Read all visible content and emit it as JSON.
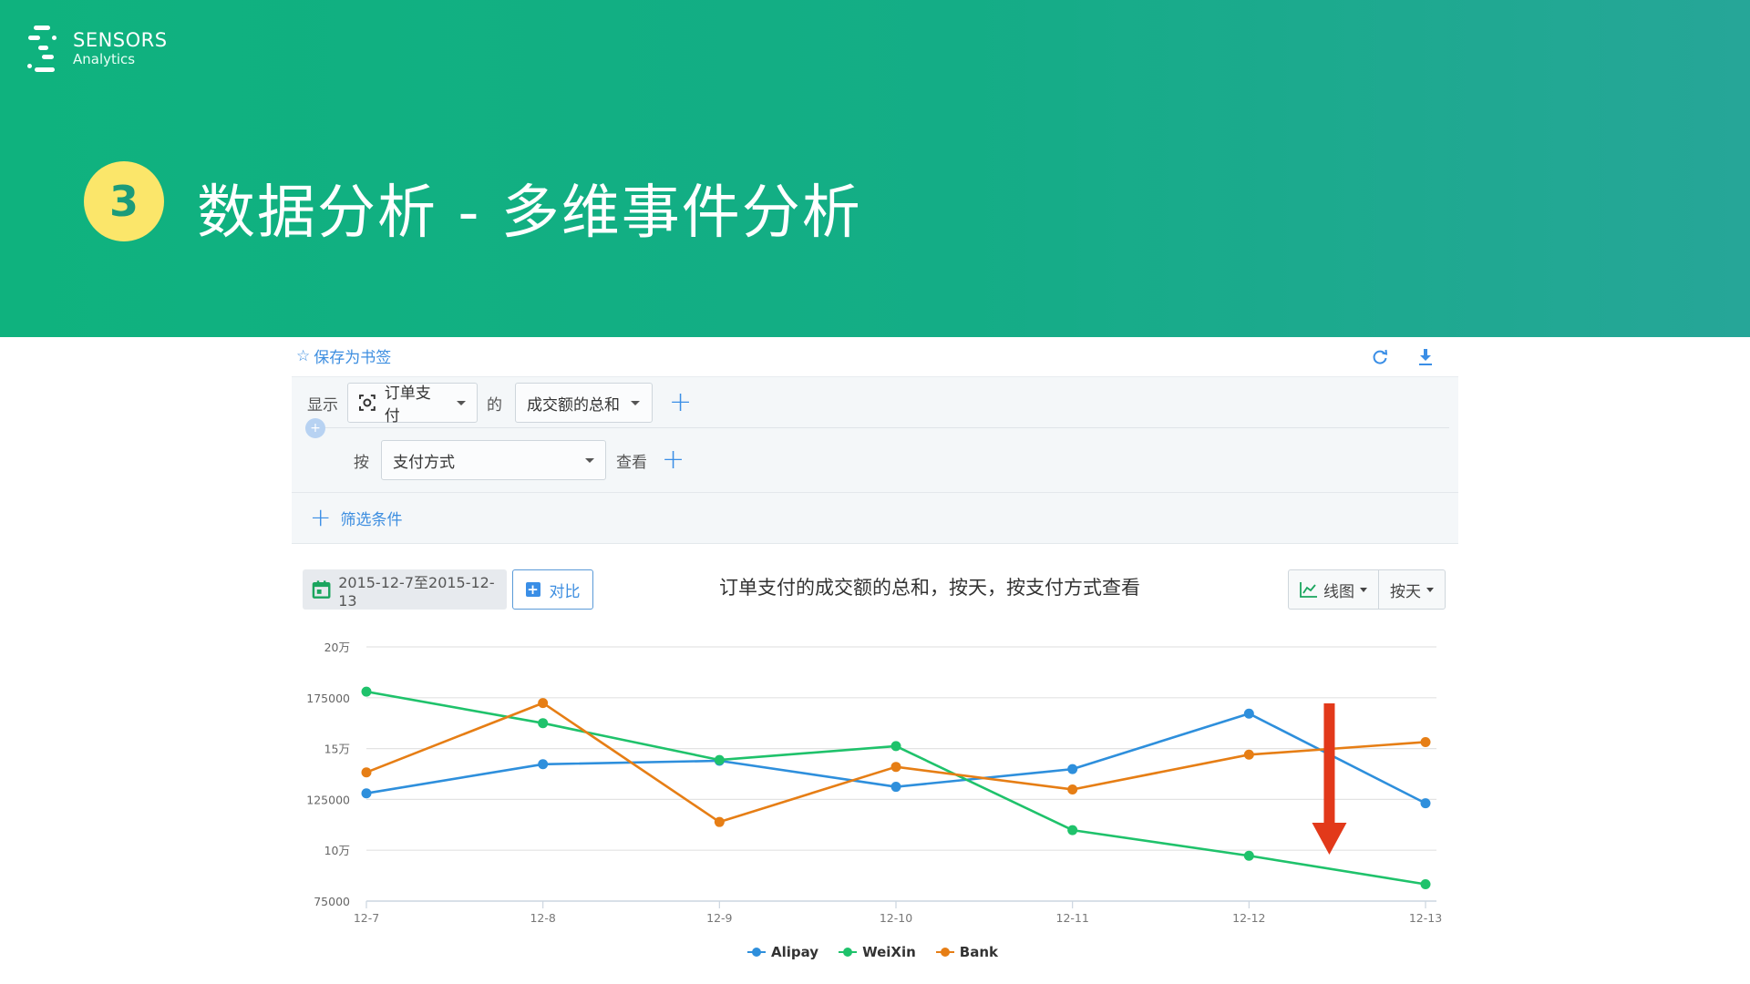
{
  "brand": {
    "name_line1": "SENSORS",
    "name_line2": "Analytics"
  },
  "slide": {
    "step_number": "3",
    "title": "数据分析 - 多维事件分析"
  },
  "toolbar": {
    "bookmark_icon": "star-outline-icon",
    "bookmark_label": "保存为书签",
    "refresh_icon": "refresh-icon",
    "download_icon": "download-icon"
  },
  "query": {
    "show_label": "显示",
    "event_icon": "event-scan-icon",
    "event_value": "订单支付",
    "of_label": "的",
    "metric_value": "成交额的总和",
    "by_label": "按",
    "group_value": "支付方式",
    "view_label": "查看",
    "add_symbol": "+",
    "filter_label": "筛选条件"
  },
  "controls": {
    "date_icon": "calendar-icon",
    "date_range": "2015-12-7至2015-12-13",
    "compare_label": "对比",
    "chart_type_icon": "line-chart-icon",
    "chart_type_label": "线图",
    "granularity_label": "按天"
  },
  "colors": {
    "brand_green": "#12b07f",
    "badge_yellow": "#fbe66a",
    "link_blue": "#3d8ee0",
    "arrow_red": "#e2391a"
  },
  "chart_data": {
    "type": "line",
    "title": "订单支付的成交额的总和，按天，按支付方式查看",
    "xlabel": "",
    "ylabel": "",
    "categories": [
      "12-7",
      "12-8",
      "12-9",
      "12-10",
      "12-11",
      "12-12",
      "12-13"
    ],
    "ylim": [
      75000,
      200000
    ],
    "yticks": [
      75000,
      100000,
      125000,
      150000,
      175000,
      200000
    ],
    "ytick_labels": [
      "75000",
      "10万",
      "125000",
      "15万",
      "175000",
      "20万"
    ],
    "grid": true,
    "legend_position": "bottom-center",
    "series": [
      {
        "name": "Alipay",
        "color": "#2e8fdc",
        "values": [
          128000,
          142300,
          144000,
          131200,
          139900,
          167200,
          123100
        ]
      },
      {
        "name": "WeiXin",
        "color": "#1fc26b",
        "values": [
          178000,
          162500,
          144400,
          151200,
          109900,
          97300,
          83300
        ]
      },
      {
        "name": "Bank",
        "color": "#e67e15",
        "values": [
          138300,
          172400,
          113900,
          141000,
          129900,
          147000,
          153200
        ]
      }
    ],
    "annotation": {
      "type": "down-arrow",
      "color": "#e2391a",
      "near_category": "12-12/12-13"
    }
  }
}
